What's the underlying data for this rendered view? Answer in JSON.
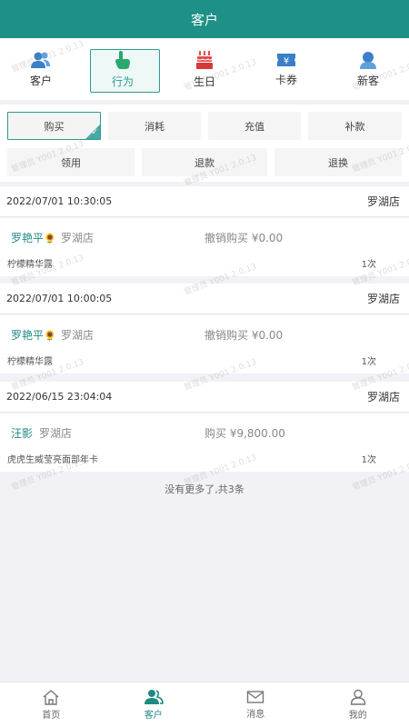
{
  "header": {
    "title": "客户"
  },
  "topnav": [
    {
      "label": "客户",
      "icon": "users-icon"
    },
    {
      "label": "行为",
      "icon": "pointer-hand-icon"
    },
    {
      "label": "生日",
      "icon": "cake-icon"
    },
    {
      "label": "卡券",
      "icon": "ticket-icon"
    },
    {
      "label": "新客",
      "icon": "new-user-icon"
    }
  ],
  "filters": {
    "row1": [
      "购买",
      "消耗",
      "充值",
      "补款"
    ],
    "row2": [
      "领用",
      "退款",
      "退换"
    ],
    "selected": "购买"
  },
  "records": [
    {
      "datetime": "2022/07/01 10:30:05",
      "store": "罗湖店",
      "customer": "罗艳平",
      "flower": "🌻",
      "customer_store": "罗湖店",
      "action": "撤销购买 ¥0.00",
      "product": "柠檬精华露",
      "times": "1次"
    },
    {
      "datetime": "2022/07/01 10:00:05",
      "store": "罗湖店",
      "customer": "罗艳平",
      "flower": "🌻",
      "customer_store": "罗湖店",
      "action": "撤销购买 ¥0.00",
      "product": "柠檬精华露",
      "times": "1次"
    },
    {
      "datetime": "2022/06/15 23:04:04",
      "store": "罗湖店",
      "customer": "汪影",
      "flower": "",
      "customer_store": "罗湖店",
      "action": "购买 ¥9,800.00",
      "product": "虎虎生威莹亮面部年卡",
      "times": "1次"
    }
  ],
  "footer_note": "没有更多了,共3条",
  "tabbar": [
    {
      "label": "首页",
      "icon": "home-icon"
    },
    {
      "label": "客户",
      "icon": "customers-icon"
    },
    {
      "label": "消息",
      "icon": "mail-icon"
    },
    {
      "label": "我的",
      "icon": "profile-icon"
    }
  ],
  "watermark": "管理员 Y001 2.0.13",
  "colors": {
    "primary": "#1e9088",
    "accent": "#2b9a92"
  }
}
